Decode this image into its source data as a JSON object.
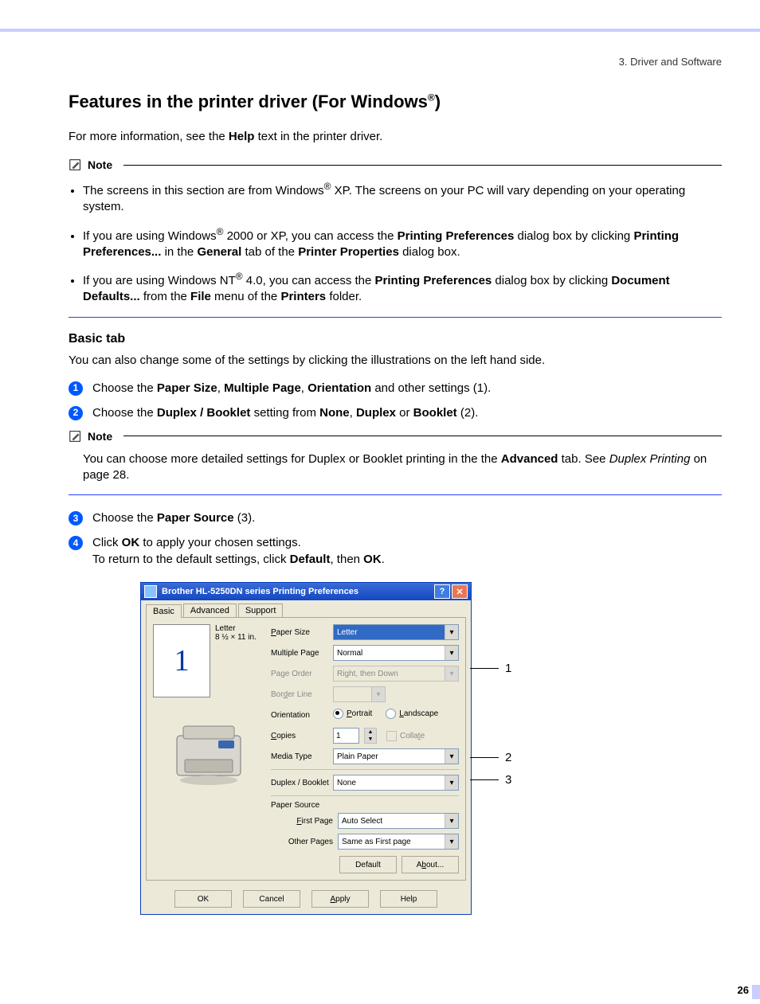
{
  "chapter": "3. Driver and Software",
  "title_a": "Features in the printer driver (For Windows",
  "title_b": ")",
  "reg": "®",
  "lead_a": "For more information, see the ",
  "lead_b": "Help",
  "lead_c": " text in the printer driver.",
  "note_label": "Note",
  "notes": {
    "n1a": "The screens in this section are from Windows",
    "n1b": " XP. The screens on your PC will vary depending on your operating system.",
    "n2a": "If you are using Windows",
    "n2b": " 2000 or XP, you can access the ",
    "n2c": "Printing Preferences",
    "n2d": " dialog box by clicking ",
    "n2e": "Printing Preferences...",
    "n2f": " in the ",
    "n2g": "General",
    "n2h": " tab of the ",
    "n2i": "Printer Properties",
    "n2j": " dialog box.",
    "n3a": "If you are using Windows NT",
    "n3b": " 4.0, you can access the ",
    "n3c": "Printing Preferences",
    "n3d": " dialog box by clicking ",
    "n3e": "Document Defaults...",
    "n3f": " from the ",
    "n3g": "File",
    "n3h": " menu of the ",
    "n3i": "Printers",
    "n3j": " folder."
  },
  "sub": "Basic tab",
  "body1": "You can also change some of the settings by clicking the illustrations on the left hand side.",
  "steps": {
    "s1a": "Choose the ",
    "s1b": "Paper Size",
    "s1c": ", ",
    "s1d": "Multiple Page",
    "s1e": ", ",
    "s1f": "Orientation",
    "s1g": " and other settings (1).",
    "s2a": "Choose the ",
    "s2b": "Duplex / Booklet",
    "s2c": " setting from ",
    "s2d": "None",
    "s2e": ", ",
    "s2f": "Duplex",
    "s2g": " or ",
    "s2h": "Booklet",
    "s2i": " (2).",
    "s3a": "Choose the ",
    "s3b": "Paper Source",
    "s3c": " (3).",
    "s4a": "Click ",
    "s4b": "OK",
    "s4c": " to apply your chosen settings.",
    "s4d": "To return to the default settings, click ",
    "s4e": "Default",
    "s4f": ", then ",
    "s4g": "OK",
    "s4h": "."
  },
  "note2a": "You can choose more detailed settings for Duplex or Booklet printing in the the ",
  "note2b": "Advanced",
  "note2c": " tab. See ",
  "note2d": "Duplex Printing",
  "note2e": " on page 28.",
  "dialog": {
    "title": "Brother HL-5250DN series Printing Preferences",
    "tabs": {
      "basic": "Basic",
      "advanced": "Advanced",
      "support": "Support"
    },
    "paper_name": "Letter",
    "paper_dim": "8 ½ × 11 in.",
    "preview_num": "1",
    "labels": {
      "paper_size_a": "P",
      "paper_size_b": "aper Size",
      "multiple_page": "Multiple Page",
      "page_order": "Page Order",
      "border_line_a": "Bor",
      "border_line_b": "d",
      "border_line_c": "er Line",
      "orientation": "Orientation",
      "copies_a": "C",
      "copies_b": "opies",
      "media_type": "Media Type",
      "duplex": "Duplex / Booklet",
      "paper_source": "Paper Source",
      "first_page_a": "F",
      "first_page_b": "irst Page",
      "other_pages": "Other Pages"
    },
    "values": {
      "paper_size": "Letter",
      "multiple_page": "Normal",
      "page_order": "Right, then Down",
      "orientation_portrait_a": "P",
      "orientation_portrait_b": "ortrait",
      "orientation_landscape_a": "L",
      "orientation_landscape_b": "andscape",
      "copies": "1",
      "collate_a": "Colla",
      "collate_b": "t",
      "collate_c": "e",
      "media_type": "Plain Paper",
      "duplex": "None",
      "first_page": "Auto Select",
      "other_pages": "Same as First page"
    },
    "buttons": {
      "default": "Default",
      "about_a": "A",
      "about_b": "b",
      "about_c": "out...",
      "ok": "OK",
      "cancel": "Cancel",
      "apply_a": "A",
      "apply_b": "pply",
      "help": "Help"
    }
  },
  "callouts": {
    "c1": "1",
    "c2": "2",
    "c3": "3"
  },
  "page_num": "26"
}
